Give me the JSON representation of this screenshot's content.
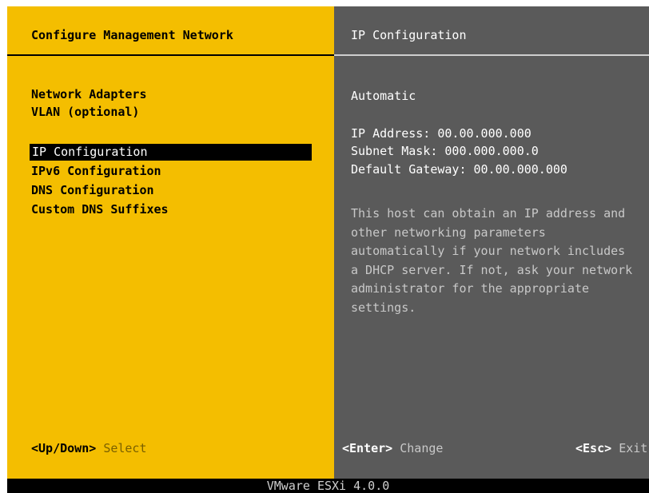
{
  "left_panel": {
    "title": "Configure Management Network",
    "items": [
      {
        "label": "Network Adapters"
      },
      {
        "label": "VLAN (optional)"
      },
      {
        "label": "IP Configuration"
      },
      {
        "label": "IPv6 Configuration"
      },
      {
        "label": "DNS Configuration"
      },
      {
        "label": "Custom DNS Suffixes"
      }
    ],
    "hint": {
      "key": "<Up/Down>",
      "desc": "Select"
    }
  },
  "right_panel": {
    "title": "IP Configuration",
    "mode": "Automatic",
    "ip_address": "IP Address: 00.00.000.000",
    "subnet_mask": "Subnet Mask: 000.000.000.0",
    "default_gateway": "Default Gateway: 00.00.000.000",
    "help_text": "This host can obtain an IP address and other networking parameters automatically if your network includes a DHCP server. If not, ask your network administrator for the appropriate settings.",
    "hint_enter": {
      "key": "<Enter>",
      "desc": "Change"
    },
    "hint_esc": {
      "key": "<Esc>",
      "desc": "Exit"
    }
  },
  "footer": {
    "product": "VMware ESXi 4.0.0"
  },
  "colors": {
    "left_bg": "#f4be00",
    "right_bg": "#5a5a5a",
    "footer_bg": "#000000"
  }
}
